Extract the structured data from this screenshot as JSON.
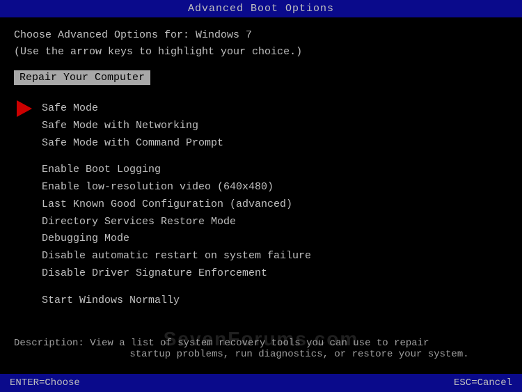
{
  "title": "Advanced Boot Options",
  "intro": {
    "line1": "Choose Advanced Options for: Windows 7",
    "line2": "(Use the arrow keys to highlight your choice.)"
  },
  "highlighted": "Repair Your Computer",
  "menu": {
    "group1": [
      {
        "label": "Safe Mode",
        "active": true
      },
      {
        "label": "Safe Mode with Networking",
        "active": false
      },
      {
        "label": "Safe Mode with Command Prompt",
        "active": false
      }
    ],
    "group2": [
      {
        "label": "Enable Boot Logging",
        "active": false
      },
      {
        "label": "Enable low-resolution video (640x480)",
        "active": false
      },
      {
        "label": "Last Known Good Configuration (advanced)",
        "active": false
      },
      {
        "label": "Directory Services Restore Mode",
        "active": false
      },
      {
        "label": "Debugging Mode",
        "active": false
      },
      {
        "label": "Disable automatic restart on system failure",
        "active": false
      },
      {
        "label": "Disable Driver Signature Enforcement",
        "active": false
      }
    ],
    "group3": [
      {
        "label": "Start Windows Normally",
        "active": false
      }
    ]
  },
  "description": {
    "line1": "Description: View a list of system recovery tools you can use to repair",
    "line2": "startup problems, run diagnostics, or restore your system."
  },
  "watermark": "SevenForums.com",
  "bottom": {
    "left": "ENTER=Choose",
    "right": "ESC=Cancel"
  }
}
